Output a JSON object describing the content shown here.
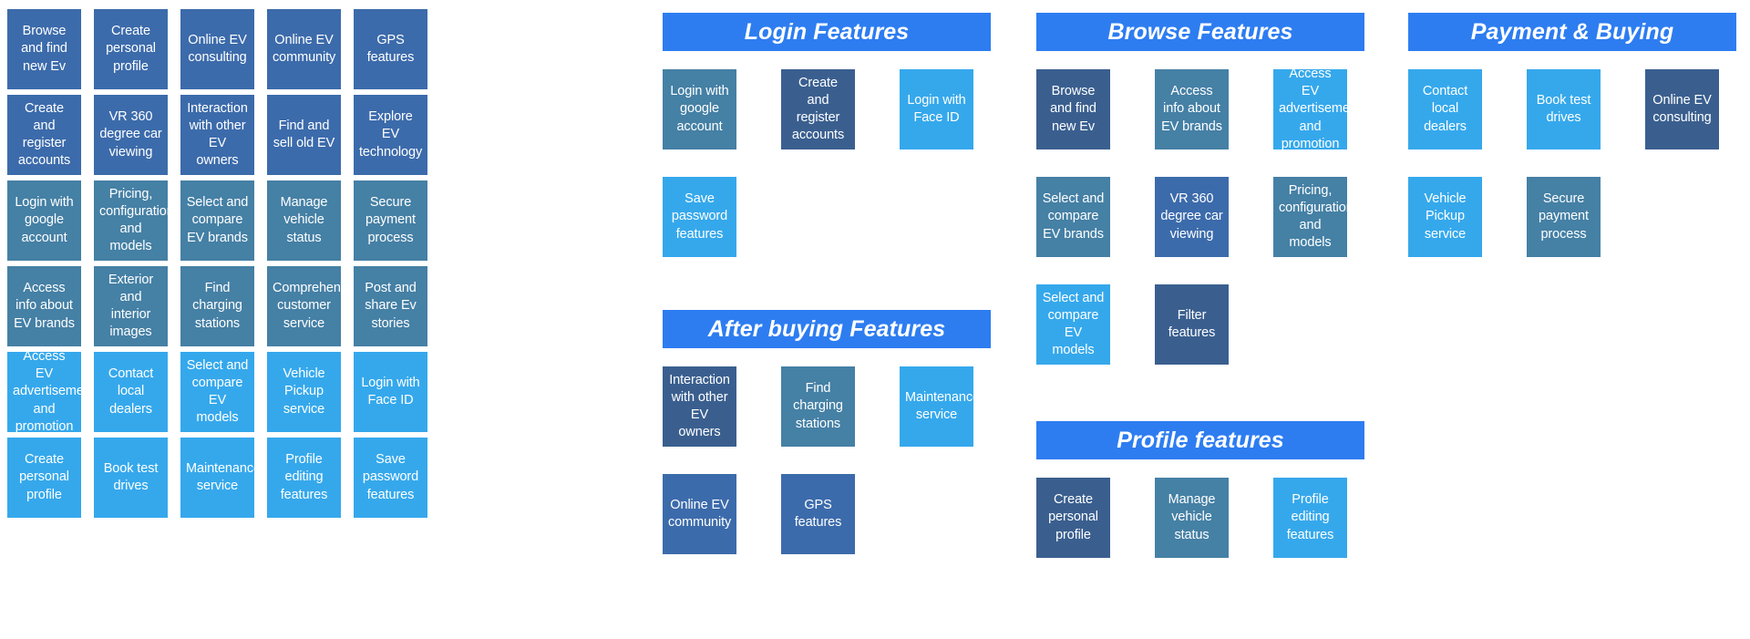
{
  "palette": {
    "dark_blue": "#3C6BAB",
    "deep_navy": "#3A5F8F",
    "teal": "#4580A5",
    "light_blue": "#35A8EC",
    "header_blue": "#2D7DF1",
    "card_text": "#FFFFFF",
    "page_background": "#FFFFFF"
  },
  "left_grid": {
    "columns": 5,
    "rows": 6,
    "cells": [
      {
        "label": "Browse and find new Ev",
        "color": "dark_blue"
      },
      {
        "label": "Create personal profile",
        "color": "dark_blue"
      },
      {
        "label": "Online EV consulting",
        "color": "dark_blue"
      },
      {
        "label": "Online EV community",
        "color": "dark_blue"
      },
      {
        "label": "GPS features",
        "color": "dark_blue"
      },
      {
        "label": "Create and register accounts",
        "color": "dark_blue"
      },
      {
        "label": "VR 360 degree car viewing",
        "color": "dark_blue"
      },
      {
        "label": "Interaction with other EV owners",
        "color": "dark_blue"
      },
      {
        "label": "Find and sell old EV",
        "color": "dark_blue"
      },
      {
        "label": "Explore EV technology",
        "color": "dark_blue"
      },
      {
        "label": "Login with google account",
        "color": "teal"
      },
      {
        "label": "Pricing, configuration, and models",
        "color": "teal"
      },
      {
        "label": "Select and compare EV brands",
        "color": "teal"
      },
      {
        "label": "Manage vehicle status",
        "color": "teal"
      },
      {
        "label": "Secure payment process",
        "color": "teal"
      },
      {
        "label": "Access info about EV brands",
        "color": "teal"
      },
      {
        "label": "Exterior and interior images",
        "color": "teal"
      },
      {
        "label": "Find charging stations",
        "color": "teal"
      },
      {
        "label": "Comprehensive customer service",
        "color": "teal"
      },
      {
        "label": "Post and share Ev stories",
        "color": "teal"
      },
      {
        "label": "Access EV advertisement and promotion",
        "color": "light_blue"
      },
      {
        "label": "Contact local dealers",
        "color": "light_blue"
      },
      {
        "label": "Select and compare EV models",
        "color": "light_blue"
      },
      {
        "label": "Vehicle Pickup service",
        "color": "light_blue"
      },
      {
        "label": "Login with Face ID",
        "color": "light_blue"
      },
      {
        "label": "Create personal profile",
        "color": "light_blue"
      },
      {
        "label": "Book test drives",
        "color": "light_blue"
      },
      {
        "label": "Maintenance service",
        "color": "light_blue"
      },
      {
        "label": "Profile editing features",
        "color": "light_blue"
      },
      {
        "label": "Save password features",
        "color": "light_blue"
      }
    ]
  },
  "panels": [
    {
      "id": "login-features",
      "title": "Login Features",
      "cards": [
        {
          "label": "Login with google account",
          "color": "teal"
        },
        {
          "label": "Create and register accounts",
          "color": "deep_navy"
        },
        {
          "label": "Login with Face ID",
          "color": "light_blue"
        },
        {
          "label": "Save password features",
          "color": "light_blue"
        }
      ]
    },
    {
      "id": "after-buying-features",
      "title": "After buying Features",
      "cards": [
        {
          "label": "Interaction with other EV owners",
          "color": "deep_navy"
        },
        {
          "label": "Find charging stations",
          "color": "teal"
        },
        {
          "label": "Maintenance service",
          "color": "light_blue"
        },
        {
          "label": "Online EV community",
          "color": "dark_blue"
        },
        {
          "label": "GPS features",
          "color": "dark_blue"
        }
      ]
    },
    {
      "id": "browse-features",
      "title": "Browse Features",
      "cards": [
        {
          "label": "Browse and find new Ev",
          "color": "deep_navy"
        },
        {
          "label": "Access info about EV brands",
          "color": "teal"
        },
        {
          "label": "Access EV advertisement and promotion",
          "color": "light_blue"
        },
        {
          "label": "Select and compare EV brands",
          "color": "teal"
        },
        {
          "label": "VR 360 degree car viewing",
          "color": "dark_blue"
        },
        {
          "label": "Pricing, configuration, and models",
          "color": "teal"
        },
        {
          "label": "Select and compare EV models",
          "color": "light_blue"
        },
        {
          "label": "Filter features",
          "color": "deep_navy"
        }
      ]
    },
    {
      "id": "profile-features",
      "title": "Profile features",
      "cards": [
        {
          "label": "Create personal profile",
          "color": "deep_navy"
        },
        {
          "label": "Manage vehicle status",
          "color": "teal"
        },
        {
          "label": "Profile editing features",
          "color": "light_blue"
        }
      ]
    },
    {
      "id": "payment-and-buying",
      "title": "Payment & Buying",
      "cards": [
        {
          "label": "Contact local dealers",
          "color": "light_blue"
        },
        {
          "label": "Book test drives",
          "color": "light_blue"
        },
        {
          "label": "Online EV consulting",
          "color": "deep_navy"
        },
        {
          "label": "Vehicle Pickup service",
          "color": "light_blue"
        },
        {
          "label": "Secure payment process",
          "color": "teal"
        }
      ]
    }
  ]
}
